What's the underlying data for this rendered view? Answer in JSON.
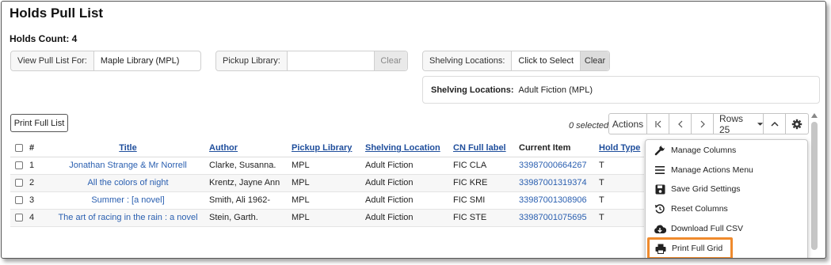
{
  "page": {
    "title": "Holds Pull List",
    "holds_count": "Holds Count: 4"
  },
  "filters": {
    "view_pull_list": {
      "label": "View Pull List For:",
      "value": "Maple Library (MPL)"
    },
    "pickup_library": {
      "label": "Pickup Library:",
      "value": "",
      "clear_label": "Clear"
    },
    "shelving_locations": {
      "label": "Shelving Locations:",
      "select_label": "Click to Select",
      "clear_label": "Clear"
    },
    "selected_locations": {
      "label": "Shelving Locations:",
      "value": "Adult Fiction (MPL)"
    }
  },
  "toolbar": {
    "print_full_list": "Print Full List",
    "selected_count": "0 selected",
    "actions_label": "Actions",
    "first_page": "|<",
    "prev_page": "<",
    "next_page": ">",
    "rows_label": "Rows 25",
    "collapse_label": "^"
  },
  "grid": {
    "columns": [
      "#",
      "Title",
      "Author",
      "Pickup Library",
      "Shelving Location",
      "CN Full label",
      "Current Item",
      "Hold Type"
    ],
    "rows": [
      {
        "num": "1",
        "title": "Jonathan Strange & Mr Norrell",
        "author": "Clarke, Susanna.",
        "pickup": "MPL",
        "shelving": "Adult Fiction",
        "cn": "FIC CLA",
        "item": "33987000664267",
        "hold_type": "T"
      },
      {
        "num": "2",
        "title": "All the colors of night",
        "author": "Krentz, Jayne Ann",
        "pickup": "MPL",
        "shelving": "Adult Fiction",
        "cn": "FIC KRE",
        "item": "33987001319374",
        "hold_type": "T"
      },
      {
        "num": "3",
        "title": "Summer : [a novel]",
        "author": "Smith, Ali 1962-",
        "pickup": "MPL",
        "shelving": "Adult Fiction",
        "cn": "FIC SMI",
        "item": "33987001308906",
        "hold_type": "T"
      },
      {
        "num": "4",
        "title": "The art of racing in the rain : a novel",
        "author": "Stein, Garth.",
        "pickup": "MPL",
        "shelving": "Adult Fiction",
        "cn": "FIC STE",
        "item": "33987001075695",
        "hold_type": "T"
      }
    ]
  },
  "settings_menu": {
    "items": [
      {
        "label": "Manage Columns",
        "icon": "wrench-icon"
      },
      {
        "label": "Manage Actions Menu",
        "icon": "bars-icon"
      },
      {
        "label": "Save Grid Settings",
        "icon": "save-icon"
      },
      {
        "label": "Reset Columns",
        "icon": "reset-icon"
      },
      {
        "label": "Download Full CSV",
        "icon": "cloud-download-icon"
      },
      {
        "label": "Print Full Grid",
        "icon": "printer-icon"
      }
    ]
  },
  "colors": {
    "link": "#2a5fb0",
    "highlight": "#ef8a2d",
    "border": "#cfcfcf"
  }
}
